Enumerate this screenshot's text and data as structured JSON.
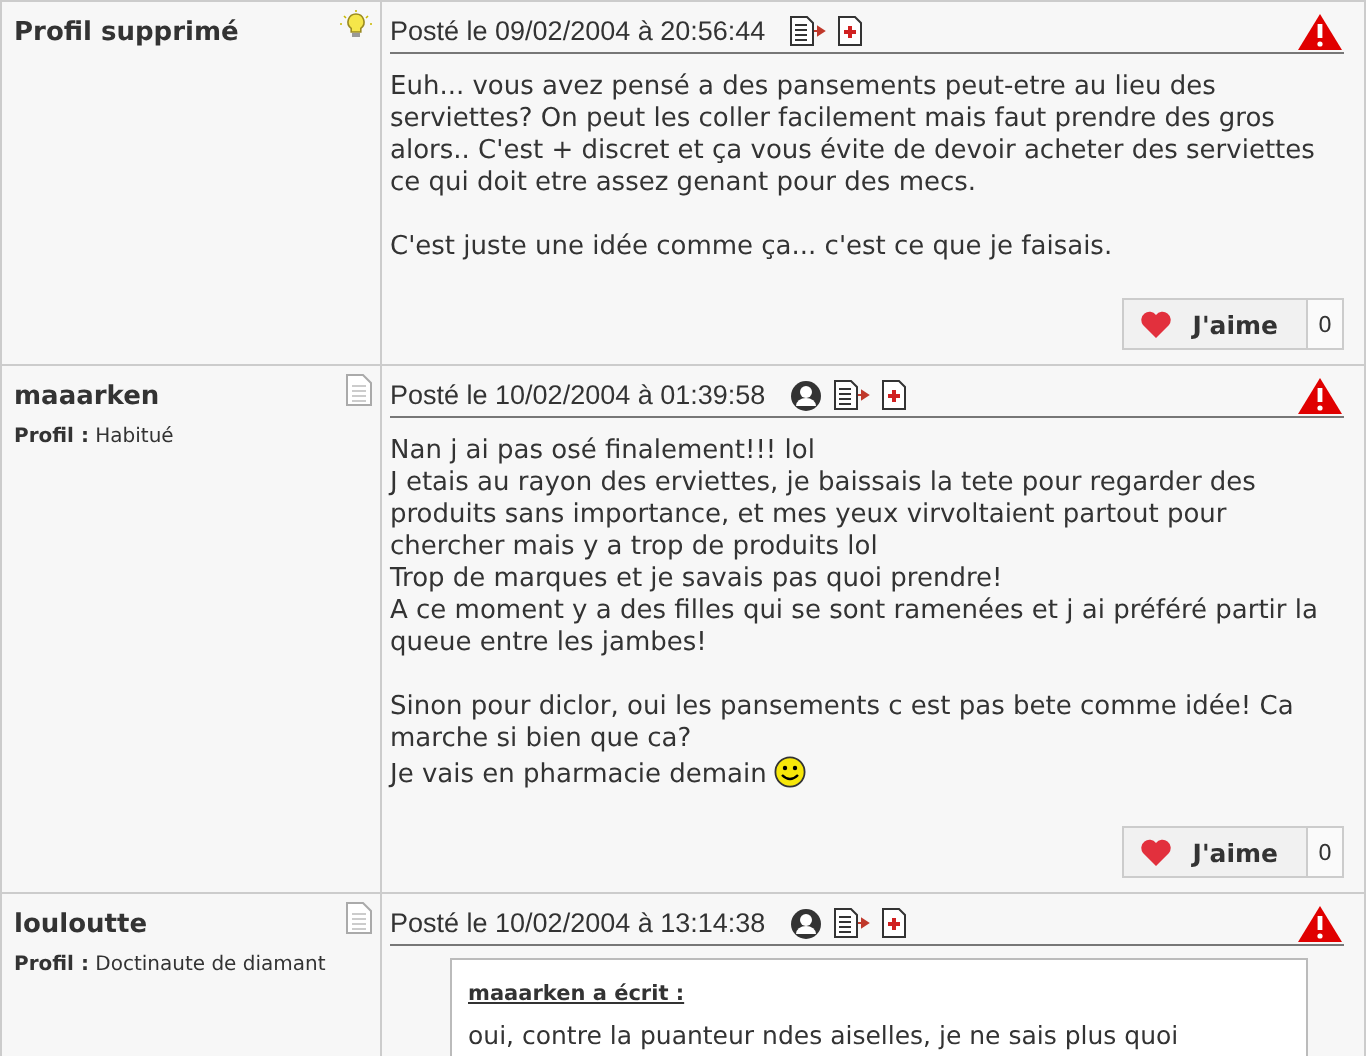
{
  "posts": [
    {
      "author": "Profil supprimé",
      "author_icon": {
        "kind": "lightbulb"
      },
      "date": "Posté le 09/02/2004 à 20:56:44",
      "profile_link": false,
      "paragraphs": [
        {
          "lines": [
            {
              "text": "Euh... vous avez pensé a des pansements peut-etre au lieu des serviettes? On peut les coller facilement mais faut prendre des gros alors.. C'est + discret et ça vous évite de devoir acheter des serviettes ce qui doit etre assez genant pour des mecs."
            }
          ]
        },
        {
          "lines": [
            {
              "text": "C'est juste une idée comme ça... c'est ce que je faisais."
            }
          ]
        }
      ],
      "like": {
        "label": "J'aime",
        "count": "0"
      }
    },
    {
      "author": "maaarken",
      "author_icon": {
        "kind": "document"
      },
      "profile": {
        "label": "Profil :",
        "value": "Habitué"
      },
      "date": "Posté le 10/02/2004 à 01:39:58",
      "profile_link": true,
      "paragraphs": [
        {
          "lines": [
            {
              "text": "Nan j ai pas osé finalement!!! lol"
            },
            {
              "text": "J etais au rayon des erviettes, je baissais la tete pour regarder des produits sans importance, et mes yeux virvoltaient partout pour chercher mais y a trop de produits lol"
            },
            {
              "text": "Trop de marques et je savais pas quoi prendre!"
            },
            {
              "text": "A ce moment y a des filles qui se sont ramenées et j ai préféré partir la queue entre les jambes!"
            }
          ]
        },
        {
          "lines": [
            {
              "text": "Sinon pour diclor, oui les pansements c est pas bete comme idée! Ca marche si bien que ca?"
            },
            {
              "text": "Je vais en pharmacie demain",
              "emoticon": {
                "kind": "smile"
              }
            }
          ]
        }
      ],
      "like": {
        "label": "J'aime",
        "count": "0"
      }
    },
    {
      "author": "louloutte",
      "author_icon": {
        "kind": "document"
      },
      "profile": {
        "label": "Profil :",
        "value": "Doctinaute de diamant"
      },
      "date": "Posté le 10/02/2004 à 13:14:38",
      "profile_link": true,
      "quote": {
        "author_line": "maaarken a écrit :",
        "text": "oui, contre la puanteur ndes aiselles, je ne sais plus quoi"
      }
    }
  ]
}
